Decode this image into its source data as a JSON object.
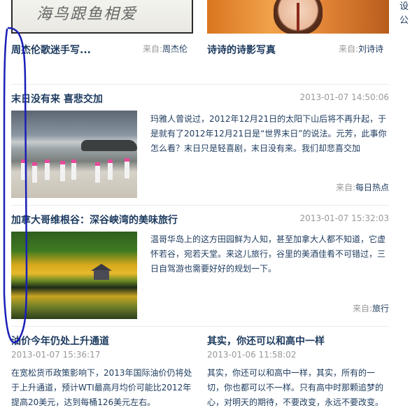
{
  "top_cards": [
    {
      "title": "周杰伦歌迷手写...",
      "source_label": "来自:",
      "source": "周杰伦",
      "image_text": "海鸟跟鱼相爱"
    },
    {
      "title": "诗诗的诗影写真",
      "source_label": "来自:",
      "source": "刘诗诗"
    }
  ],
  "right_edge_chars": [
    "设",
    "公"
  ],
  "articles": [
    {
      "title": "末日没有来 喜悲交加",
      "date": "2013-01-07 14:50:06",
      "summary": "玛雅人曾说过，2012年12月21日的太阳下山后将不再升起，于是就有了2012年12月21日是“世界末日”的说法。元芳，此事你怎么看？末日只是轻喜剧，末日没有来。我们却悲喜交加",
      "source_label": "来自:",
      "source": "每日热点",
      "image": "beach-photo"
    },
    {
      "title": "加拿大哥维根谷：深谷峡湾的美味旅行",
      "date": "2013-01-07 15:32:03",
      "summary": "温哥华岛上的这方田园鲜为人知，甚至加拿大人都不知道，它虚怀若谷，宛若天堂。来这儿旅行，谷里的美酒佳肴不可错过，三日自驾游也需要好好的规划一下。",
      "source_label": "来自:",
      "source": "旅行",
      "image": "lake-photo"
    }
  ],
  "bottom_cards": [
    {
      "title": "油价今年仍处上升通道",
      "date": "2013-01-07 15:36:17",
      "summary": "在宽松货币政策影响下，2013年国际油价仍将处于上升通道，预计WTI最高月均价可能比2012年提高20美元，达到每桶126美元左右。"
    },
    {
      "title": "其实，你还可以和高中一样",
      "date": "2013-01-06 11:58:02",
      "summary": "其实，你还可以和高中一样，其实，所有的一切，你也都可以不一样。只有高中时那颗追梦的心，对明天的期待，不要改变，永远不要改变。"
    }
  ]
}
